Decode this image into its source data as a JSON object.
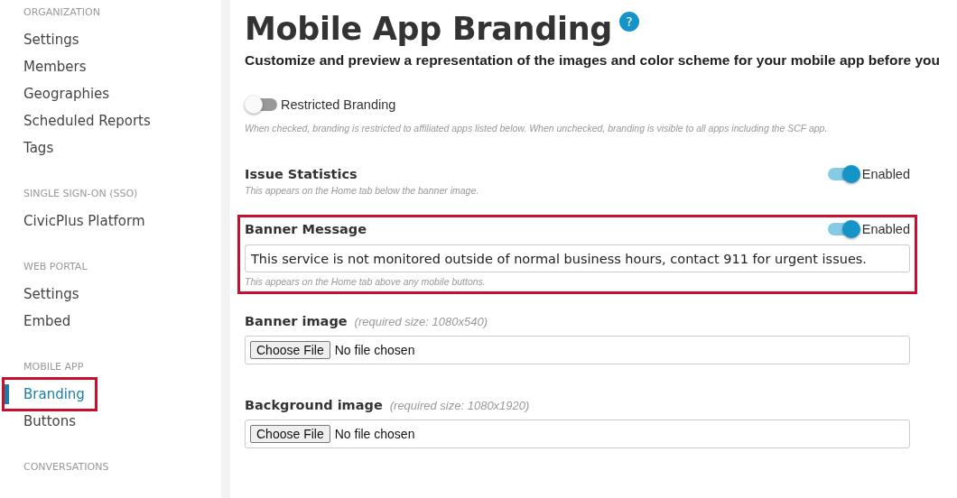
{
  "sidebar": {
    "sections": [
      {
        "heading": "ORGANIZATION",
        "items": [
          {
            "label": "Settings",
            "selected": false,
            "highlighted": false
          },
          {
            "label": "Members",
            "selected": false,
            "highlighted": false
          },
          {
            "label": "Geographies",
            "selected": false,
            "highlighted": false
          },
          {
            "label": "Scheduled Reports",
            "selected": false,
            "highlighted": false
          },
          {
            "label": "Tags",
            "selected": false,
            "highlighted": false
          }
        ]
      },
      {
        "heading": "SINGLE SIGN-ON (SSO)",
        "items": [
          {
            "label": "CivicPlus Platform",
            "selected": false,
            "highlighted": false
          }
        ]
      },
      {
        "heading": "WEB PORTAL",
        "items": [
          {
            "label": "Settings",
            "selected": false,
            "highlighted": false
          },
          {
            "label": "Embed",
            "selected": false,
            "highlighted": false
          }
        ]
      },
      {
        "heading": "MOBILE APP",
        "items": [
          {
            "label": "Branding",
            "selected": true,
            "highlighted": true
          },
          {
            "label": "Buttons",
            "selected": false,
            "highlighted": false
          }
        ]
      },
      {
        "heading": "CONVERSATIONS"
      }
    ]
  },
  "page": {
    "title": "Mobile App Branding",
    "help": "?",
    "subtitle": "Customize and preview a representation of the images and color scheme for your mobile app before you"
  },
  "settings": [
    {
      "kind": "toggle",
      "label": "Restricted Branding",
      "on": false,
      "hint": "When checked, branding is restricted to affiliated apps listed below. When unchecked, branding is visible to all apps including the SCF app."
    },
    {
      "kind": "feature",
      "label": "Issue Statistics",
      "on": true,
      "state_label": "Enabled",
      "hint": "This appears on the Home tab below the banner image.",
      "highlighted": false
    },
    {
      "kind": "feature",
      "label": "Banner Message",
      "on": true,
      "state_label": "Enabled",
      "value": "This service is not monitored outside of normal business hours, contact 911 for urgent issues.",
      "hint": "This appears on the Home tab above any mobile buttons.",
      "highlighted": true
    },
    {
      "kind": "file",
      "label": "Banner image",
      "note": "(required size: 1080x540)",
      "button": "Choose File",
      "status": "No file chosen"
    },
    {
      "kind": "file",
      "label": "Background image",
      "note": "(required size: 1080x1920)",
      "button": "Choose File",
      "status": "No file chosen"
    }
  ]
}
